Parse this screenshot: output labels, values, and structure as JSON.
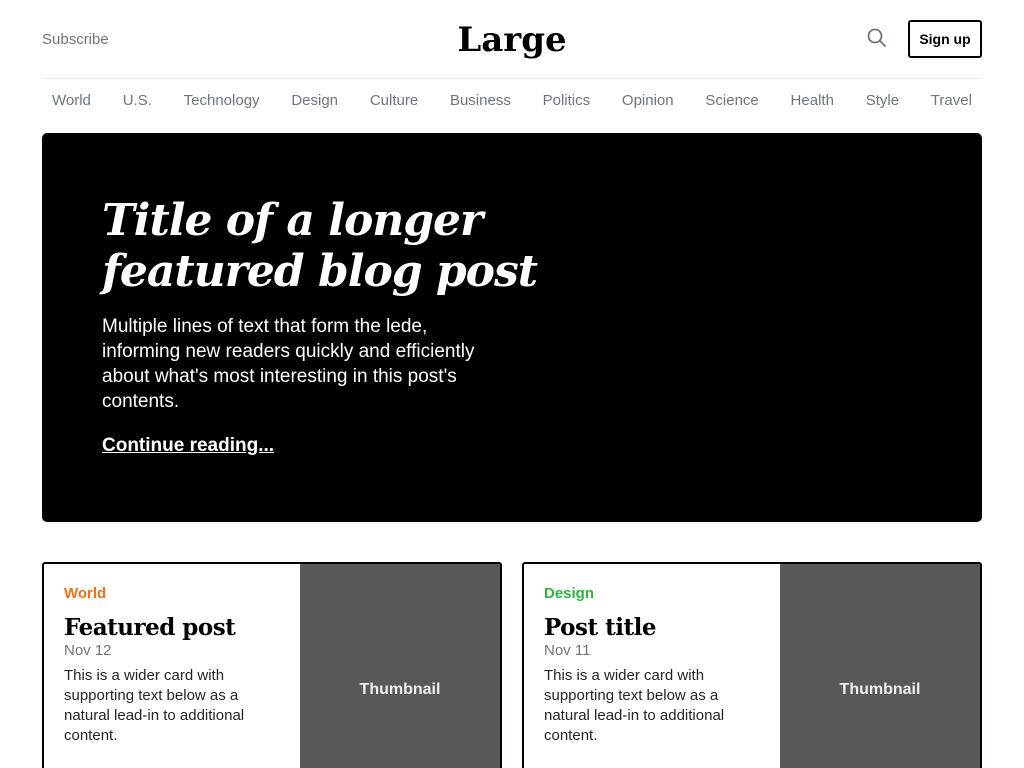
{
  "header": {
    "subscribe_label": "Subscribe",
    "brand": "Large",
    "search_icon": "search-icon",
    "signup_label": "Sign up"
  },
  "nav": {
    "items": [
      "World",
      "U.S.",
      "Technology",
      "Design",
      "Culture",
      "Business",
      "Politics",
      "Opinion",
      "Science",
      "Health",
      "Style",
      "Travel"
    ]
  },
  "hero": {
    "title": "Title of a longer featured blog post",
    "lede": "Multiple lines of text that form the lede, informing new readers quickly and efficiently about what's most interesting in this post's contents.",
    "link_label": "Continue reading..."
  },
  "cards": [
    {
      "category": "World",
      "category_color": "#e8711c",
      "title": "Featured post",
      "date": "Nov 12",
      "text": "This is a wider card with supporting text below as a natural lead-in to additional content.",
      "thumbnail_label": "Thumbnail"
    },
    {
      "category": "Design",
      "category_color": "#2fb344",
      "title": "Post title",
      "date": "Nov 11",
      "text": "This is a wider card with supporting text below as a natural lead-in to additional content.",
      "thumbnail_label": "Thumbnail"
    }
  ],
  "colors": {
    "hero_background": "#000000",
    "thumbnail_background": "#55595c",
    "muted_text": "#6c757d"
  }
}
